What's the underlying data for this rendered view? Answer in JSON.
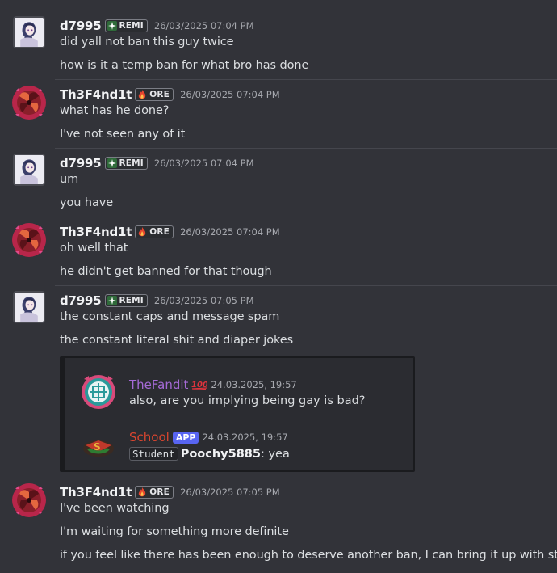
{
  "colors": {
    "background": "#323339",
    "embed_background": "#2b2c31",
    "thefandit_name": "#a56ad6",
    "school_name": "#d9452f",
    "app_badge": "#5865f2"
  },
  "messages": [
    {
      "author": "d7995",
      "tag": "REMI",
      "tag_icon": "sparkle-icon",
      "timestamp": "26/03/2025 07:04 PM",
      "lines": [
        "did yall not ban this guy twice",
        "how is it a temp ban for what bro has done"
      ]
    },
    {
      "author": "Th3F4nd1t",
      "tag": "ORE",
      "tag_icon": "flame-icon",
      "timestamp": "26/03/2025 07:04 PM",
      "lines": [
        "what has he done?",
        "I've not seen any of it"
      ]
    },
    {
      "author": "d7995",
      "tag": "REMI",
      "tag_icon": "sparkle-icon",
      "timestamp": "26/03/2025 07:04 PM",
      "lines": [
        "um",
        "you have"
      ]
    },
    {
      "author": "Th3F4nd1t",
      "tag": "ORE",
      "tag_icon": "flame-icon",
      "timestamp": "26/03/2025 07:04 PM",
      "lines": [
        "oh well that",
        "he didn't get banned for that though"
      ]
    },
    {
      "author": "d7995",
      "tag": "REMI",
      "tag_icon": "sparkle-icon",
      "timestamp": "26/03/2025 07:05 PM",
      "lines": [
        "the constant caps and message spam",
        "the constant literal shit and diaper jokes"
      ]
    },
    {
      "author": "Th3F4nd1t",
      "tag": "ORE",
      "tag_icon": "flame-icon",
      "timestamp": "26/03/2025 07:05 PM",
      "lines": [
        "I've been watching",
        "I'm waiting for something more definite",
        "if you feel like there has been enough to deserve another ban, I can bring it up with staff"
      ]
    }
  ],
  "embed": {
    "quote1": {
      "author": "TheFandit",
      "badge_icon": "hundred-icon",
      "timestamp": "24.03.2025, 19:57",
      "text": "also, are you implying being gay is bad?"
    },
    "quote2": {
      "author": "School",
      "badge": "APP",
      "timestamp": "24.03.2025, 19:57",
      "role": "Student",
      "mention": "Poochy5885",
      "separator": ":",
      "text": "yea"
    }
  }
}
